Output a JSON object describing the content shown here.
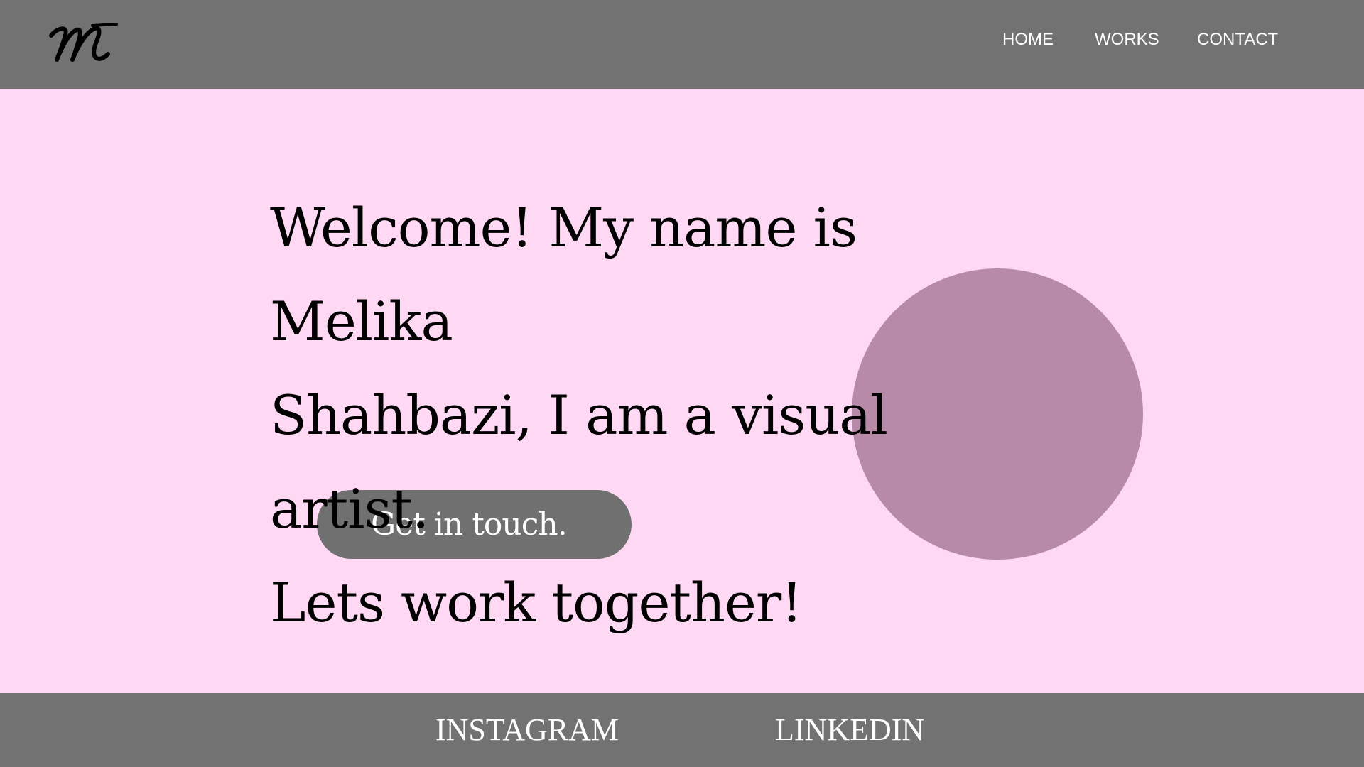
{
  "colors": {
    "background": "#ffd9f4",
    "header_footer": "#737273",
    "button": "#707070",
    "circle": "#b7a3af",
    "text": "#000000",
    "nav_text": "#ffffff"
  },
  "header": {
    "logo_icon": "script-m-logo",
    "nav": [
      {
        "label": "HOME"
      },
      {
        "label": "WORKS"
      },
      {
        "label": "CONTACT"
      }
    ]
  },
  "hero": {
    "lines": [
      "Welcome! My name is Melika",
      "Shahbazi, I am a visual artist.",
      "Lets work together!"
    ],
    "cta_label": "Get in touch."
  },
  "footer": {
    "links": [
      {
        "label": "INSTAGRAM"
      },
      {
        "label": "LINKEDIN"
      }
    ]
  }
}
